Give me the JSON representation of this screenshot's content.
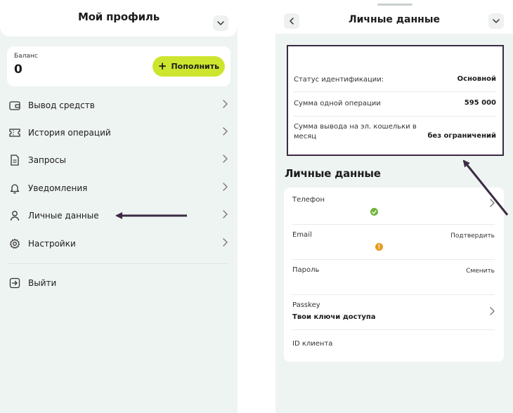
{
  "left": {
    "title": "Мой профиль",
    "balance": {
      "label": "Баланс",
      "value": "0",
      "topup_label": "Пополнить"
    },
    "menu": [
      {
        "label": "Вывод средств",
        "icon": "wallet-icon"
      },
      {
        "label": "История операций",
        "icon": "ticket-icon"
      },
      {
        "label": "Запросы",
        "icon": "document-icon"
      },
      {
        "label": "Уведомления",
        "icon": "bell-icon"
      },
      {
        "label": "Личные данные",
        "icon": "user-icon"
      },
      {
        "label": "Настройки",
        "icon": "gear-icon"
      }
    ],
    "logout_label": "Выйти"
  },
  "right": {
    "title": "Личные данные",
    "status": [
      {
        "label": "Статус идентификации:",
        "value": "Основной"
      },
      {
        "label": "Сумма одной операции",
        "value": "595 000"
      },
      {
        "label": "Сумма вывода на эл. кошельки в месяц",
        "value": "без ограничений"
      }
    ],
    "section_title": "Личные данные",
    "fields": {
      "phone": {
        "label": "Телефон",
        "status": "verified"
      },
      "email": {
        "label": "Email",
        "action": "Подтвердить",
        "status": "warning"
      },
      "password": {
        "label": "Пароль",
        "action": "Сменить"
      },
      "passkey": {
        "label": "Passkey",
        "value": "Твои ключи доступа"
      },
      "client_id": {
        "label": "ID клиента"
      }
    }
  },
  "colors": {
    "accent": "#cde52e",
    "background": "#eef4f1",
    "annotation": "#3b2b44",
    "ok": "#6fb33b",
    "warn": "#e99a1c"
  }
}
